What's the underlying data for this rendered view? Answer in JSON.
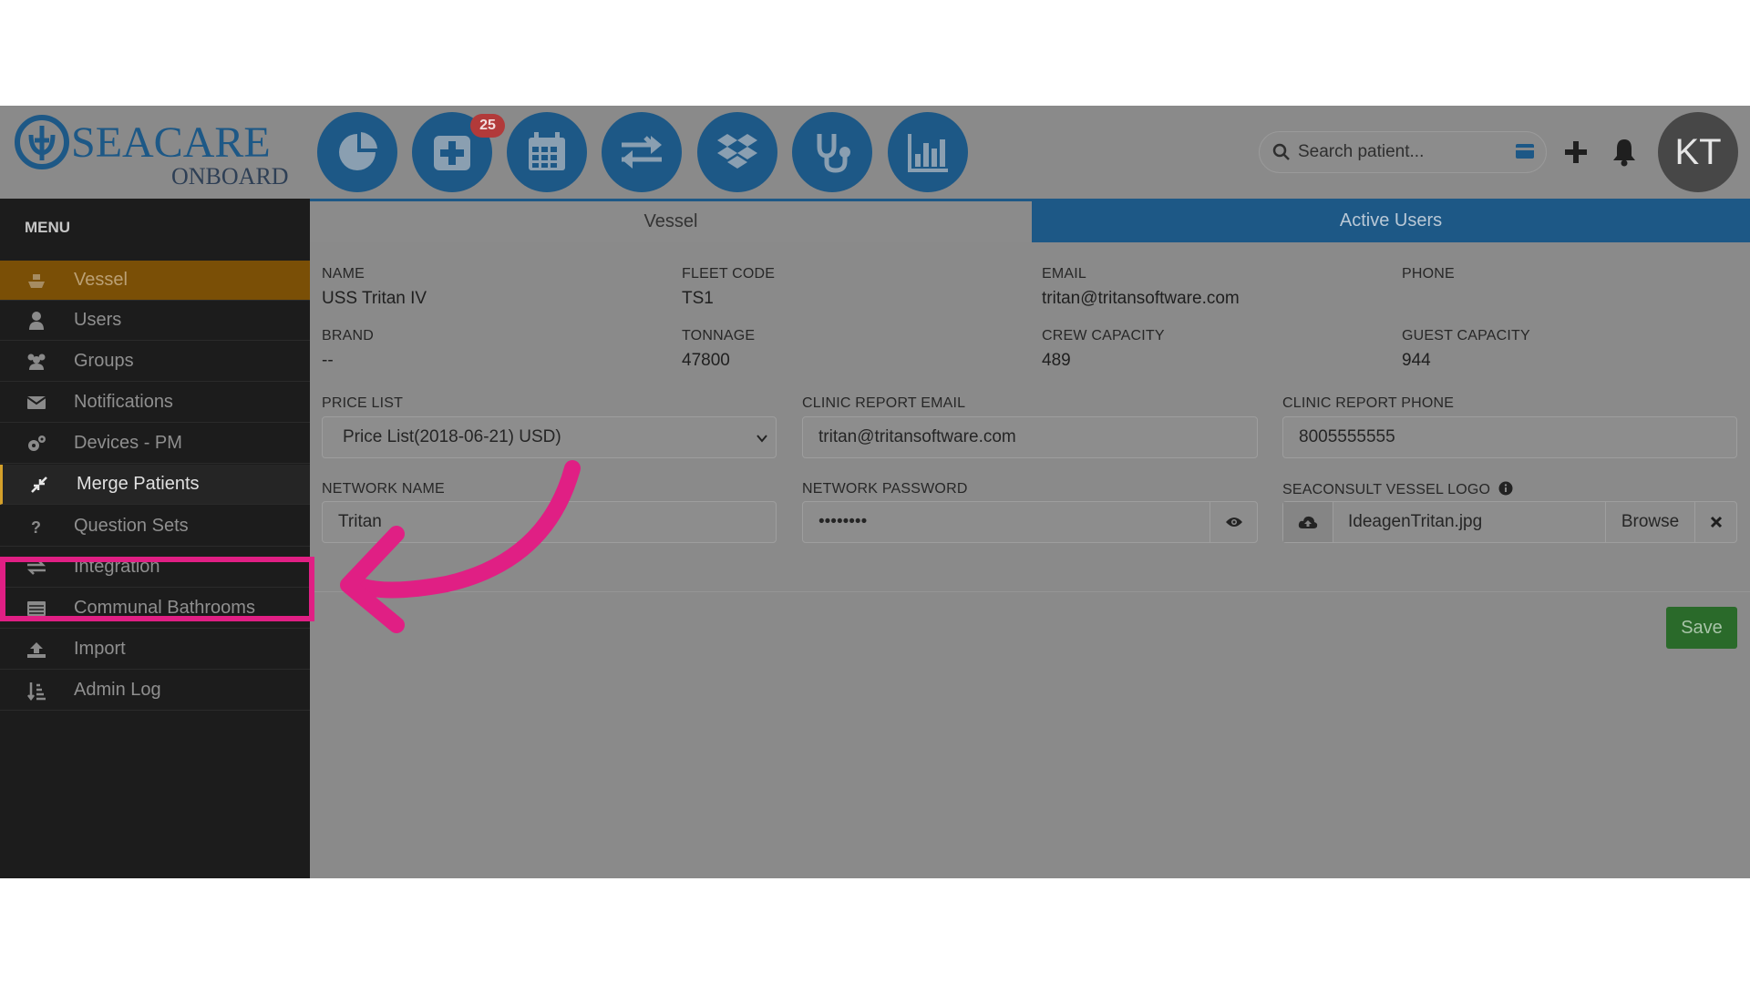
{
  "header": {
    "logo_top": "SEACARE",
    "logo_bottom": "ONBOARD",
    "badge_count": "25",
    "search_placeholder": "Search patient...",
    "avatar_initials": "KT",
    "nav_icons": [
      "dashboard-pie-icon",
      "medical-plus-icon",
      "calendar-icon",
      "transfer-arrows-icon",
      "dropbox-icon",
      "stethoscope-icon",
      "bar-chart-icon"
    ]
  },
  "sidebar": {
    "menu_label": "MENU",
    "items": [
      {
        "label": "Vessel",
        "icon": "ship-icon"
      },
      {
        "label": "Users",
        "icon": "user-icon"
      },
      {
        "label": "Groups",
        "icon": "users-icon"
      },
      {
        "label": "Notifications",
        "icon": "envelope-icon"
      },
      {
        "label": "Devices - PM",
        "icon": "cogs-icon"
      },
      {
        "label": "Merge Patients",
        "icon": "compress-icon"
      },
      {
        "label": "Question Sets",
        "icon": "question-icon"
      },
      {
        "label": "Integration",
        "icon": "exchange-icon"
      },
      {
        "label": "Communal Bathrooms",
        "icon": "list-icon"
      },
      {
        "label": "Import",
        "icon": "upload-icon"
      },
      {
        "label": "Admin Log",
        "icon": "sort-icon"
      }
    ]
  },
  "tabs": {
    "vessel": "Vessel",
    "active_users": "Active Users"
  },
  "vessel": {
    "name_label": "NAME",
    "name": "USS Tritan IV",
    "fleet_code_label": "FLEET CODE",
    "fleet_code": "TS1",
    "email_label": "EMAIL",
    "email": "tritan@tritansoftware.com",
    "phone_label": "PHONE",
    "phone": "",
    "brand_label": "BRAND",
    "brand": "--",
    "tonnage_label": "TONNAGE",
    "tonnage": "47800",
    "crew_capacity_label": "CREW CAPACITY",
    "crew_capacity": "489",
    "guest_capacity_label": "GUEST CAPACITY",
    "guest_capacity": "944"
  },
  "form": {
    "price_list_label": "PRICE LIST",
    "price_list_value": "Price List(2018-06-21) USD)",
    "clinic_email_label": "CLINIC REPORT EMAIL",
    "clinic_email_value": "tritan@tritansoftware.com",
    "clinic_phone_label": "CLINIC REPORT PHONE",
    "clinic_phone_value": "8005555555",
    "network_name_label": "NETWORK NAME",
    "network_name_value": "Tritan",
    "network_password_label": "NETWORK PASSWORD",
    "network_password_value": "••••••••",
    "logo_label": "SEACONSULT VESSEL LOGO",
    "logo_file": "IdeagenTritan.jpg",
    "browse_label": "Browse",
    "save_label": "Save"
  },
  "colors": {
    "accent_blue": "#1d5886",
    "highlight_pink": "#e01f84",
    "active_orange": "#7a4f06",
    "save_green": "#2a6a2a"
  }
}
